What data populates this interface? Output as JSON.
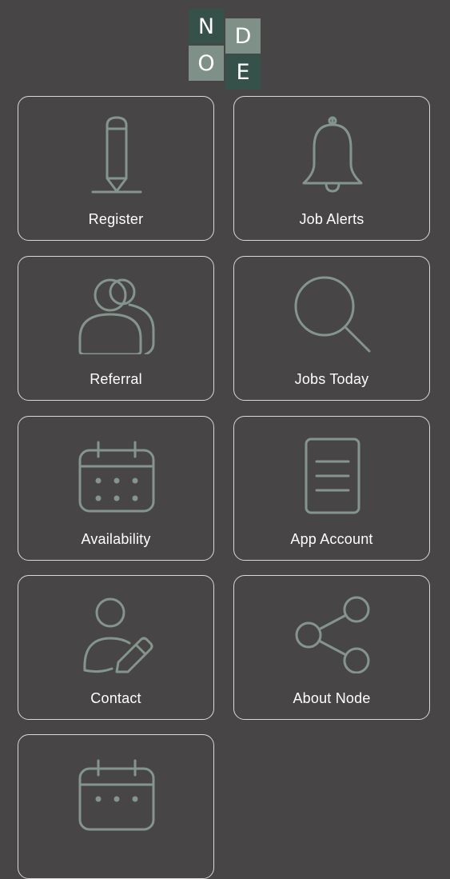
{
  "logo": {
    "letters": [
      "N",
      "D",
      "O",
      "E"
    ]
  },
  "menu": [
    {
      "label": "Register",
      "icon": "pencil-icon"
    },
    {
      "label": "Job Alerts",
      "icon": "bell-icon"
    },
    {
      "label": "Referral",
      "icon": "users-icon"
    },
    {
      "label": "Jobs Today",
      "icon": "search-icon"
    },
    {
      "label": "Availability",
      "icon": "calendar-icon"
    },
    {
      "label": "App Account",
      "icon": "document-icon"
    },
    {
      "label": "Contact",
      "icon": "user-edit-icon"
    },
    {
      "label": "About Node",
      "icon": "share-icon"
    },
    {
      "label": "",
      "icon": "calendar-icon"
    }
  ],
  "colors": {
    "background": "#474546",
    "icon_stroke": "#84958d",
    "tile_border": "#d9d9d9",
    "logo_dark": "#35514a",
    "logo_light": "#7e9088"
  }
}
